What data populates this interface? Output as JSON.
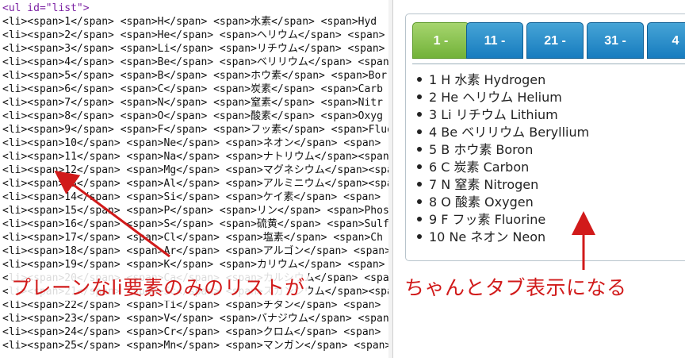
{
  "code": {
    "header": "<ul id=\"list\">",
    "lines": [
      "<li><span>1</span> <span>H</span> <span>水素</span> <span>Hyd",
      "<li><span>2</span> <span>He</span> <span>ヘリウム</span> <span>",
      "<li><span>3</span> <span>Li</span> <span>リチウム</span> <span>",
      "<li><span>4</span> <span>Be</span> <span>ベリリウム</span> <span>",
      "<li><span>5</span> <span>B</span> <span>ホウ素</span> <span>Bor",
      "<li><span>6</span> <span>C</span> <span>炭素</span> <span>Carb",
      "<li><span>7</span> <span>N</span> <span>窒素</span> <span>Nitr",
      "<li><span>8</span> <span>O</span> <span>酸素</span> <span>Oxyg",
      "<li><span>9</span> <span>F</span> <span>フッ素</span> <span>Fluo",
      "<li><span>10</span> <span>Ne</span> <span>ネオン</span> <span>",
      "<li><span>11</span> <span>Na</span> <span>ナトリウム</span><span",
      "<li><span>12</span> <span>Mg</span> <span>マグネシウム</span><span",
      "<li><span>13</span> <span>Al</span> <span>アルミニウム</span><span",
      "<li><span>14</span> <span>Si</span> <span>ケイ素</span> <span>",
      "<li><span>15</span> <span>P</span> <span>リン</span> <span>Phos",
      "<li><span>16</span> <span>S</span> <span>硫黄</span> <span>Sulf",
      "<li><span>17</span> <span>Cl</span> <span>塩素</span> <span>Ch",
      "<li><span>18</span> <span>Ar</span> <span>アルゴン</span> <span>",
      "<li><span>19</span> <span>K</span> <span>カリウム</span> <span>",
      "<li><span>20</span> <span>Ca</span> <span>カルシウム</span> <span",
      "<li><span>21</span> <span>Sc</span> <span>スカンジウム</span><span",
      "<li><span>22</span> <span>Ti</span> <span>チタン</span> <span>",
      "<li><span>23</span> <span>V</span> <span>バナジウム</span> <span>",
      "<li><span>24</span> <span>Cr</span> <span>クロム</span> <span>",
      "<li><span>25</span> <span>Mn</span> <span>マンガン</span> <span>"
    ]
  },
  "tabs": [
    "1 -",
    "11 -",
    "21 -",
    "31 -",
    "4"
  ],
  "active_tab": 0,
  "elements": [
    "2 He ヘリウム Helium",
    "3 Li リチウム Lithium",
    "4 Be ベリリウム Beryllium",
    "5 B ホウ素 Boron",
    "6 C 炭素 Carbon",
    "7 N 窒素 Nitrogen",
    "8 O 酸素 Oxygen",
    "9 F フッ素 Fluorine",
    "10 Ne ネオン Neon"
  ],
  "first_element": "1 H 水素 Hydrogen",
  "annotations": {
    "left": "プレーンなli要素のみのリストが",
    "right": "ちゃんとタブ表示になる"
  },
  "colors": {
    "tab_active": "#72b239",
    "tab_inactive": "#177cbf",
    "annotation": "#d11a1a",
    "tag": "#7a1fa2"
  }
}
